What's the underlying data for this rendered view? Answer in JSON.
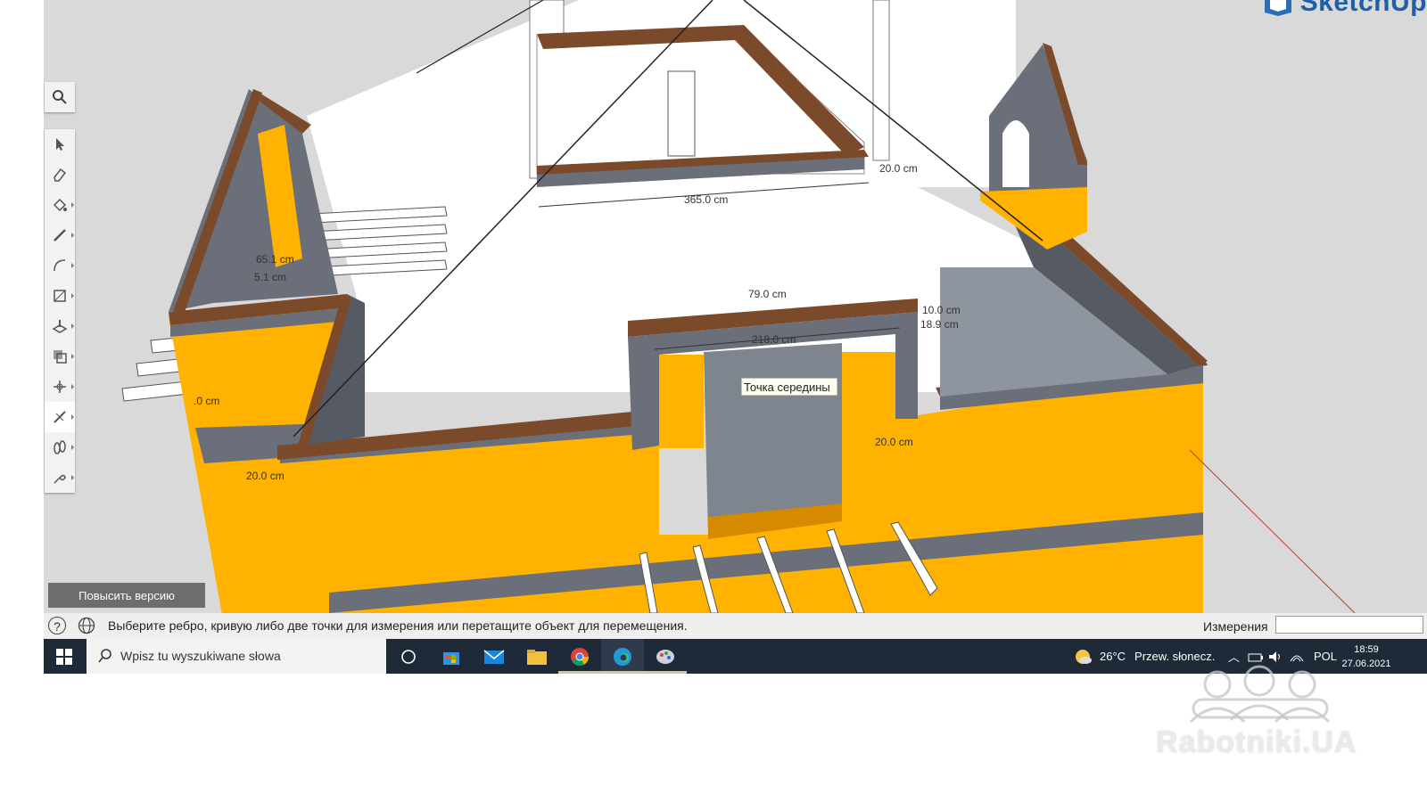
{
  "app": {
    "brand": "SketchUp",
    "upgrade_button": "Повысить версию",
    "tooltip": "Точка середины",
    "dimensions": [
      "365.0 cm",
      "20.0 cm",
      "218.0 cm",
      "10.0 cm",
      "18.9 cm",
      "20.0 cm",
      "20.0 cm",
      "65.1 cm",
      "5.1 cm",
      "79.0 cm",
      ".0 cm"
    ]
  },
  "toolbar": {
    "search_icon": "search-icon",
    "tools": [
      "select-icon",
      "eraser-icon",
      "paint-bucket-icon",
      "pencil-icon",
      "arc-icon",
      "rectangle-icon",
      "push-pull-icon",
      "offset-icon",
      "move-icon",
      "tape-measure-icon",
      "walk-icon",
      "section-icon"
    ],
    "active_tool": "tape-measure-icon"
  },
  "statusbar": {
    "message": "Выберите ребро, кривую либо две точки для измерения или перетащите объект для перемещения.",
    "measurements_label": "Измерения",
    "measurements_value": ""
  },
  "taskbar": {
    "search_placeholder": "Wpisz tu wyszukiwane słowa",
    "apps": [
      "task-view-icon",
      "store-icon",
      "mail-icon",
      "file-explorer-icon",
      "chrome-icon",
      "edge-icon",
      "sketchup-icon"
    ],
    "weather_temp": "26°C",
    "weather_desc": "Przew. słonecz.",
    "language": "POL",
    "time": "18:59",
    "date": "27.06.2021"
  },
  "watermark": "Rabotniki.UA",
  "colors": {
    "insulation": "#ffb300",
    "wall_gray": "#6b6f7a",
    "wood_trim": "#7a4a2a",
    "viewport_bg": "#d9d9d9",
    "taskbar_bg": "#1e2a38"
  }
}
